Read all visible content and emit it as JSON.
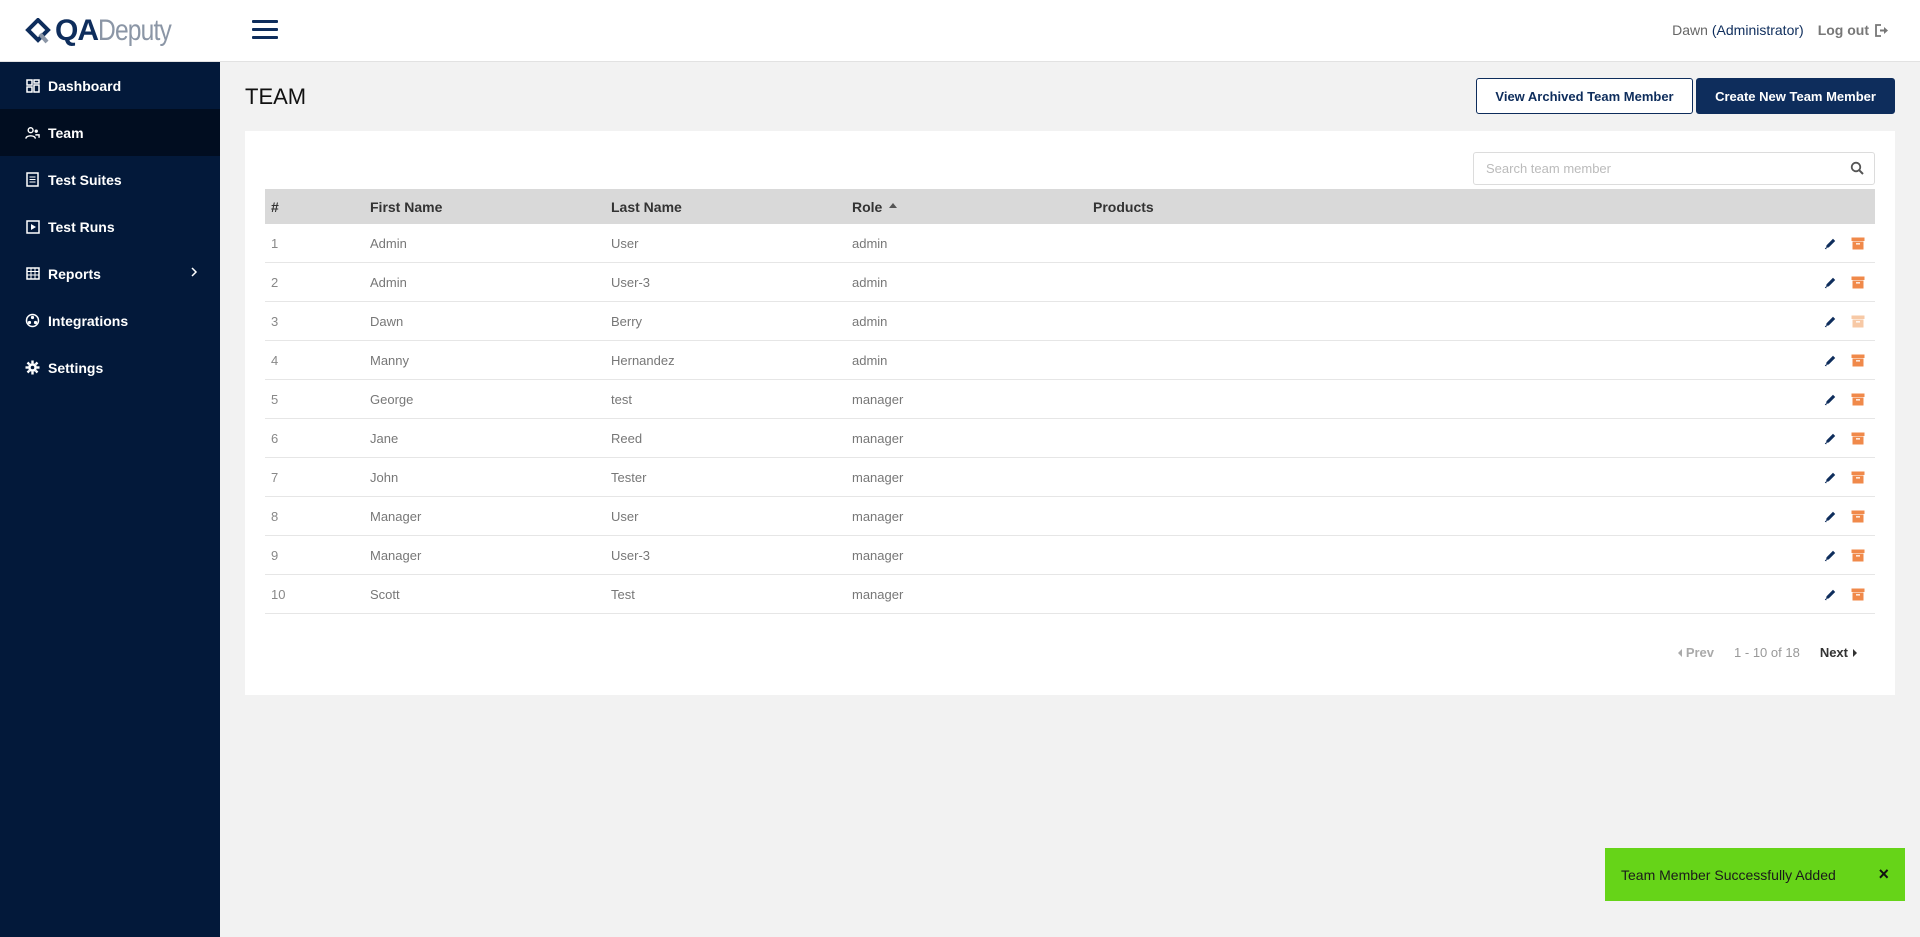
{
  "brand": {
    "part1": "QA",
    "part2": "Deputy"
  },
  "sidebar": {
    "items": [
      {
        "label": "Dashboard",
        "icon": "dashboard-icon"
      },
      {
        "label": "Team",
        "icon": "team-icon",
        "active": true
      },
      {
        "label": "Test Suites",
        "icon": "test-suites-icon"
      },
      {
        "label": "Test Runs",
        "icon": "test-runs-icon"
      },
      {
        "label": "Reports",
        "icon": "reports-icon"
      },
      {
        "label": "Integrations",
        "icon": "integrations-icon"
      },
      {
        "label": "Settings",
        "icon": "gear-icon"
      }
    ]
  },
  "header": {
    "user_name": "Dawn",
    "user_role": "(Administrator)",
    "logout_label": "Log out"
  },
  "page": {
    "title": "TEAM",
    "archived_button": "View Archived Team Member",
    "create_button": "Create New Team Member"
  },
  "search": {
    "placeholder": "Search team member"
  },
  "table": {
    "headers": {
      "num": "#",
      "first": "First Name",
      "last": "Last Name",
      "role": "Role",
      "products": "Products"
    },
    "rows": [
      {
        "num": "1",
        "first": "Admin",
        "last": "User",
        "role": "admin",
        "products": ""
      },
      {
        "num": "2",
        "first": "Admin",
        "last": "User-3",
        "role": "admin",
        "products": ""
      },
      {
        "num": "3",
        "first": "Dawn",
        "last": "Berry",
        "role": "admin",
        "products": ""
      },
      {
        "num": "4",
        "first": "Manny",
        "last": "Hernandez",
        "role": "admin",
        "products": ""
      },
      {
        "num": "5",
        "first": "George",
        "last": "test",
        "role": "manager",
        "products": ""
      },
      {
        "num": "6",
        "first": "Jane",
        "last": "Reed",
        "role": "manager",
        "products": ""
      },
      {
        "num": "7",
        "first": "John",
        "last": "Tester",
        "role": "manager",
        "products": ""
      },
      {
        "num": "8",
        "first": "Manager",
        "last": "User",
        "role": "manager",
        "products": ""
      },
      {
        "num": "9",
        "first": "Manager",
        "last": "User-3",
        "role": "manager",
        "products": ""
      },
      {
        "num": "10",
        "first": "Scott",
        "last": "Test",
        "role": "manager",
        "products": ""
      }
    ]
  },
  "pagination": {
    "prev": "Prev",
    "range": "1 - 10 of 18",
    "next": "Next"
  },
  "toast": {
    "message": "Team Member Successfully Added",
    "close": "×"
  },
  "colors": {
    "sidebar": "#03193a",
    "primary": "#0e2d5c",
    "archive": "#f0894a",
    "toast": "#66d418"
  }
}
